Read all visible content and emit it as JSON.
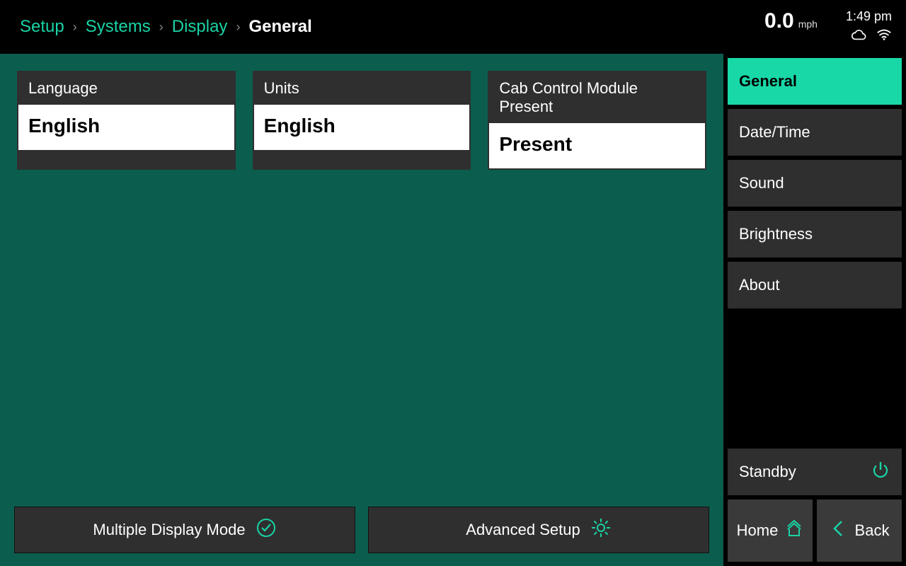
{
  "breadcrumb": {
    "items": [
      "Setup",
      "Systems",
      "Display"
    ],
    "current": "General"
  },
  "status": {
    "speed_value": "0.0",
    "speed_unit": "mph",
    "clock": "1:49 pm"
  },
  "cards": [
    {
      "label": "Language",
      "value": "English"
    },
    {
      "label": "Units",
      "value": "English"
    },
    {
      "label": "Cab Control Module Present",
      "value": "Present"
    }
  ],
  "actions": {
    "multiple_display": "Multiple Display Mode",
    "advanced_setup": "Advanced Setup"
  },
  "sidebar": {
    "items": [
      "General",
      "Date/Time",
      "Sound",
      "Brightness",
      "About"
    ],
    "standby": "Standby",
    "home": "Home",
    "back": "Back"
  },
  "colors": {
    "accent": "#19d3a5",
    "panel_bg": "#0b5e4e"
  }
}
